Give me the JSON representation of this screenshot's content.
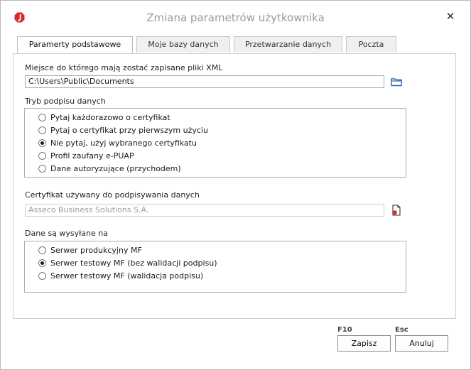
{
  "window": {
    "title": "Zmiana parametrów użytkownika"
  },
  "icons": {
    "app": "app-logo-icon",
    "close": "close-icon",
    "folder": "folder-icon",
    "certificate": "certificate-icon"
  },
  "colors": {
    "logo": "#d62a2a",
    "folder": "#2c62b4",
    "certificate_seal": "#c8301c"
  },
  "tabs": [
    {
      "label": "Paramerty podstawowe",
      "active": true
    },
    {
      "label": "Moje bazy danych",
      "active": false
    },
    {
      "label": "Przetwarzanie danych",
      "active": false
    },
    {
      "label": "Poczta",
      "active": false
    }
  ],
  "xml_location": {
    "label": "Miejsce do którego mają zostać zapisane pliki XML",
    "value": "C:\\Users\\Public\\Documents"
  },
  "signature_mode": {
    "label": "Tryb podpisu danych",
    "options": [
      {
        "label": "Pytaj każdorazowo o certyfikat",
        "checked": false
      },
      {
        "label": "Pytaj o certyfikat przy pierwszym użyciu",
        "checked": false
      },
      {
        "label": "Nie pytaj, użyj wybranego certyfikatu",
        "checked": true
      },
      {
        "label": "Profil zaufany e-PUAP",
        "checked": false
      },
      {
        "label": "Dane autoryzujące (przychodem)",
        "checked": false
      }
    ]
  },
  "certificate": {
    "label": "Certyfikat używany do podpisywania danych",
    "value": "Asseco Business Solutions S.A."
  },
  "send_target": {
    "label": "Dane są wysyłane na",
    "options": [
      {
        "label": "Serwer produkcyjny MF",
        "checked": false
      },
      {
        "label": "Serwer testowy MF (bez walidacji podpisu)",
        "checked": true
      },
      {
        "label": "Serwer testowy MF (walidacja podpisu)",
        "checked": false
      }
    ]
  },
  "footer": {
    "save": {
      "shortcut": "F10",
      "label": "Zapisz"
    },
    "cancel": {
      "shortcut": "Esc",
      "label": "Anuluj"
    }
  }
}
